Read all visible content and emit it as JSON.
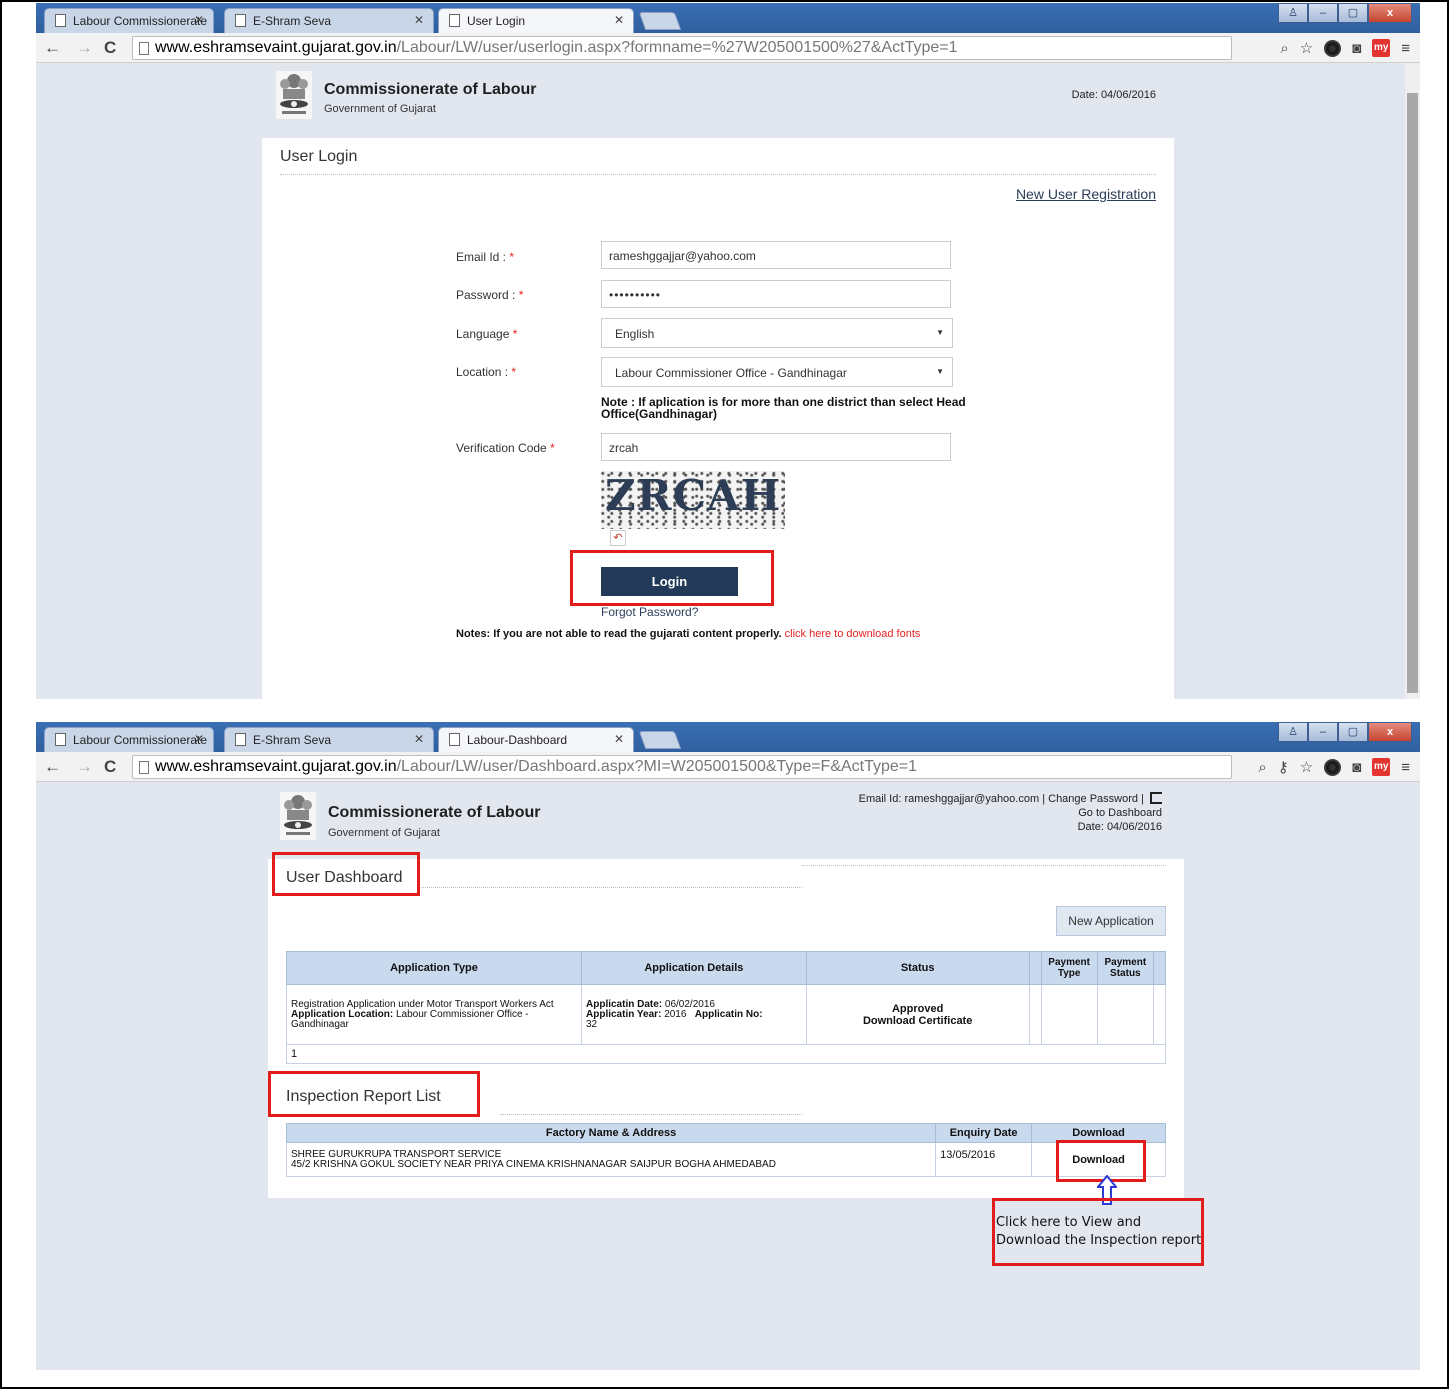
{
  "login_window": {
    "tabs": [
      {
        "label": "Labour Commissionerate"
      },
      {
        "label": "E-Shram Seva"
      },
      {
        "label": "User Login"
      }
    ],
    "url_host": "www.eshramsevaint.gujarat.gov.in",
    "url_path": "/Labour/LW/user/userlogin.aspx?formname=%27W205001500%27&ActType=1",
    "header": {
      "org": "Commissionerate of Labour",
      "gov": "Government of Gujarat",
      "date": "Date: 04/06/2016"
    },
    "panel_title": "User Login",
    "new_user_link": "New User Registration",
    "form": {
      "email_label": "Email Id :",
      "email_value": "rameshggajjar@yahoo.com",
      "password_label": "Password :",
      "password_value": "••••••••••",
      "language_label": "Language",
      "language_value": "English",
      "location_label": "Location :",
      "location_value": "Labour Commissioner Office - Gandhinagar",
      "note": "Note : If aplication is for more than one district than select Head Office(Gandhinagar)",
      "verification_label": "Verification Code",
      "verification_value": "zrcah",
      "captcha_text": "ZRCAH",
      "required_mark": "*"
    },
    "login_button": "Login",
    "forgot_password": "Forgot Password?",
    "notes_text": "Notes: If you are not able to read the gujarati content properly.",
    "notes_link": "click here to download fonts"
  },
  "dashboard_window": {
    "tabs": [
      {
        "label": "Labour Commissionerate"
      },
      {
        "label": "E-Shram Seva"
      },
      {
        "label": "Labour-Dashboard"
      }
    ],
    "url_host": "www.eshramsevaint.gujarat.gov.in",
    "url_path": "/Labour/LW/user/Dashboard.aspx?MI=W205001500&Type=F&ActType=1",
    "header": {
      "org": "Commissionerate of Labour",
      "gov": "Government of Gujarat",
      "email_text": "Email Id: rameshggajjar@yahoo.com",
      "change_password": "Change Password",
      "separator": "|",
      "go_dashboard": "Go to Dashboard",
      "date": "Date: 04/06/2016"
    },
    "dashboard_title": "User Dashboard",
    "new_application": "New Application",
    "app_table": {
      "headers": [
        "Application Type",
        "Application Details",
        "Status",
        "Payment Type",
        "Payment Status"
      ],
      "row": {
        "type_text": "Registration Application under Motor Transport Workers Act",
        "location_label": "Application Location:",
        "location_value": "Labour Commissioner Office - Gandhinagar",
        "date_label": "Applicatin Date:",
        "date_value": "06/02/2016",
        "year_label": "Applicatin Year:",
        "year_value": "2016",
        "no_label": "Applicatin No:",
        "no_value": "32",
        "status": "Approved",
        "download_certificate": "Download Certificate"
      },
      "pager": "1"
    },
    "inspection_title": "Inspection Report List",
    "inspection_table": {
      "headers": [
        "Factory Name & Address",
        "Enquiry Date",
        "Download"
      ],
      "row": {
        "factory_name": "SHREE GURUKRUPA TRANSPORT SERVICE",
        "factory_address": "45/2 KRISHNA GOKUL SOCIETY NEAR PRIYA CINEMA KRISHNANAGAR SAIJPUR BOGHA AHMEDABAD",
        "enquiry_date": "13/05/2016",
        "download": "Download"
      }
    },
    "callout_text": "Click here to View and Download the Inspection report"
  },
  "colors": {
    "page_bg": "#e1e6ef",
    "login_button": "#223957",
    "highlight_red": "#e21b1b",
    "required_red": "#e52222",
    "table_header": "#c9d9ee"
  }
}
